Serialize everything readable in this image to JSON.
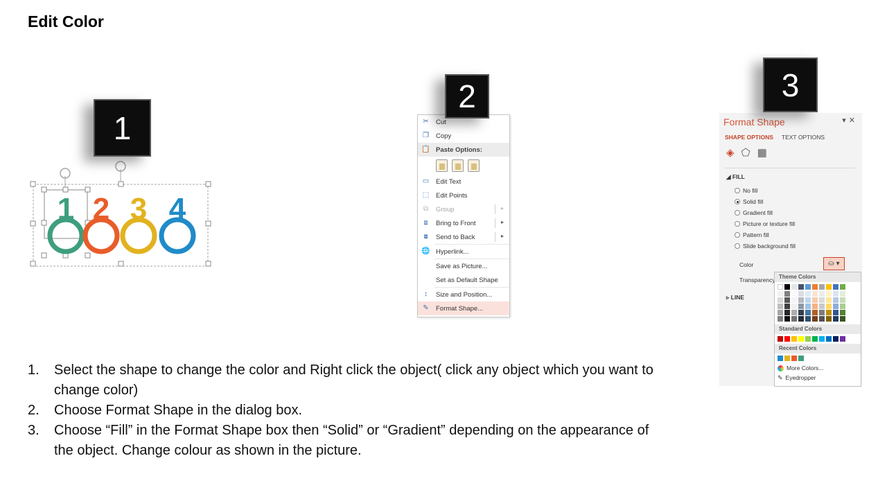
{
  "title": "Edit Color",
  "steps_boxes": [
    "1",
    "2",
    "3"
  ],
  "shape_preview": {
    "digits": [
      "1",
      "2",
      "3",
      "4"
    ],
    "colors": [
      "#3e9e7f",
      "#e85d2a",
      "#e2b21f",
      "#1f8bc8"
    ]
  },
  "context_menu": {
    "items": [
      {
        "label": "Cut",
        "icon": "scissors-icon",
        "disabled": false
      },
      {
        "label": "Copy",
        "icon": "copy-icon",
        "disabled": false
      },
      {
        "label": "Paste Options:",
        "icon": "paste-icon",
        "header": true
      },
      {
        "label": "Edit Text",
        "icon": "edit-text-icon",
        "disabled": false
      },
      {
        "label": "Edit Points",
        "icon": "edit-points-icon",
        "disabled": false
      },
      {
        "label": "Group",
        "icon": "group-icon",
        "disabled": true,
        "submenu": true
      },
      {
        "label": "Bring to Front",
        "icon": "bring-front-icon",
        "disabled": false,
        "submenu": true
      },
      {
        "label": "Send to Back",
        "icon": "send-back-icon",
        "disabled": false,
        "submenu": true
      },
      {
        "label": "Hyperlink...",
        "icon": "hyperlink-icon",
        "disabled": false
      },
      {
        "label": "Save as Picture...",
        "icon": "",
        "disabled": false
      },
      {
        "label": "Set as Default Shape",
        "icon": "",
        "disabled": false
      },
      {
        "label": "Size and Position...",
        "icon": "size-icon",
        "disabled": false
      },
      {
        "label": "Format Shape...",
        "icon": "format-shape-icon",
        "disabled": false,
        "highlight": true
      }
    ]
  },
  "format_pane": {
    "title": "Format Shape",
    "tabs": [
      "SHAPE OPTIONS",
      "TEXT OPTIONS"
    ],
    "fill_section": "FILL",
    "fill_options": [
      "No fill",
      "Solid fill",
      "Gradient fill",
      "Picture or texture fill",
      "Pattern fill",
      "Slide background fill"
    ],
    "selected_fill": "Solid fill",
    "color_label": "Color",
    "transparency_label": "Transparency",
    "line_section": "LINE"
  },
  "color_picker": {
    "theme_header": "Theme Colors",
    "standard_header": "Standard Colors",
    "recent_header": "Recent Colors",
    "more_colors": "More Colors...",
    "eyedropper": "Eyedropper",
    "theme_colors": [
      "#ffffff",
      "#000000",
      "#e7e6e6",
      "#44546a",
      "#5b9bd5",
      "#ed7d31",
      "#a5a5a5",
      "#ffc000",
      "#4472c4",
      "#70ad47"
    ],
    "standard_colors": [
      "#c00000",
      "#ff0000",
      "#ffc000",
      "#ffff00",
      "#92d050",
      "#00b050",
      "#00b0f0",
      "#0070c0",
      "#002060",
      "#7030a0"
    ],
    "recent_colors": [
      "#1f8bc8",
      "#e2b21f",
      "#e85d2a",
      "#3e9e7f"
    ]
  },
  "instructions": [
    {
      "num": "1.",
      "text": "Select the shape to change the color and Right click the object( click any object which you want to change color)"
    },
    {
      "num": "2.",
      "text": "Choose Format Shape in the dialog box."
    },
    {
      "num": "3.",
      "text": "Choose “Fill” in the Format Shape box then “Solid” or “Gradient” depending on the appearance of the object. Change colour as shown in the picture."
    }
  ]
}
